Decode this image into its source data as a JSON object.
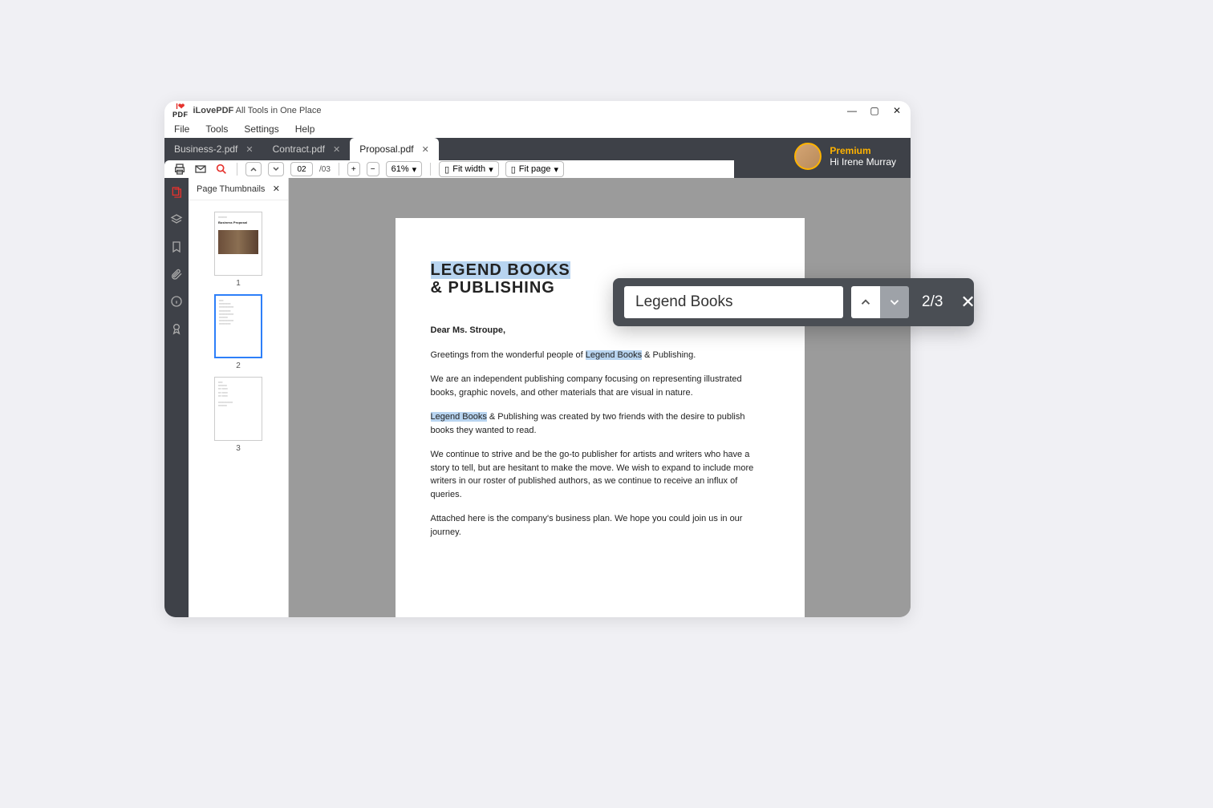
{
  "app": {
    "brand_top": "I❤",
    "brand_bottom": "PDF",
    "title_bold": "iLovePDF",
    "title_rest": " All Tools in One Place"
  },
  "menu": {
    "file": "File",
    "tools": "Tools",
    "settings": "Settings",
    "help": "Help"
  },
  "tabs": [
    {
      "label": "Business-2.pdf",
      "active": false
    },
    {
      "label": "Contract.pdf",
      "active": false
    },
    {
      "label": "Proposal.pdf",
      "active": true
    }
  ],
  "user": {
    "premium": "Premium",
    "greeting": "Hi Irene Murray"
  },
  "toolbar": {
    "page_current": "02",
    "page_total": "/03",
    "zoom": "61%",
    "fit_width": "Fit width",
    "fit_page": "Fit page"
  },
  "thumbs": {
    "title": "Page Thumbnails",
    "items": [
      {
        "num": "1",
        "kind": "cover",
        "cover_title": "Business Proposal"
      },
      {
        "num": "2",
        "kind": "text",
        "selected": true
      },
      {
        "num": "3",
        "kind": "text"
      }
    ]
  },
  "document": {
    "heading_line1": "LEGEND BOOKS",
    "heading_line2": "& PUBLISHING",
    "greeting": "Dear Ms. Stroupe,",
    "para1_pre": "Greetings from the wonderful people of ",
    "para1_hl": "Legend Books",
    "para1_post": " & Publishing.",
    "para2": "We are an independent publishing company focusing on representing illustrated books, graphic novels, and other materials that are visual in nature.",
    "para3_hl": "Legend Books",
    "para3_post": " & Publishing was created by two friends with the desire to publish books they wanted to read.",
    "para4": "We continue to strive and be the go-to publisher for artists and writers who have a story to tell, but are hesitant to make the move. We wish to expand to include more writers in our roster of published authors, as we continue to receive an influx of queries.",
    "para5": "Attached here is the company's business plan. We hope you could join us in our journey."
  },
  "search": {
    "query": "Legend Books",
    "count": "2/3"
  }
}
